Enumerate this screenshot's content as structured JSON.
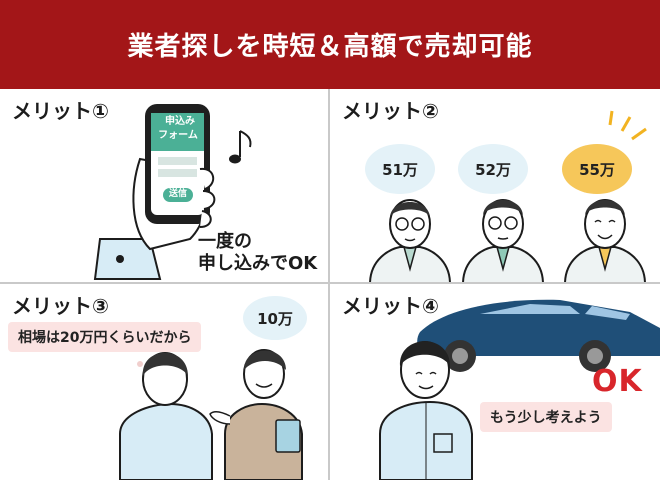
{
  "header": {
    "title": "業者探しを時短＆高額で売却可能"
  },
  "panels": {
    "p1": {
      "title": "メリット①",
      "phone_lines": [
        "申込み",
        "フォーム"
      ],
      "send_button": "送信",
      "caption_lines": [
        "一度の",
        "申し込みでOK"
      ]
    },
    "p2": {
      "title": "メリット②",
      "offers": [
        "51万",
        "52万",
        "55万"
      ]
    },
    "p3": {
      "title": "メリット③",
      "thought": "相場は20万円くらいだから",
      "offer": "10万"
    },
    "p4": {
      "title": "メリット④",
      "ok": "OK",
      "thought": "もう少し考えよう"
    }
  },
  "colors": {
    "header_bg": "#a31618",
    "gold": "#f6c75a",
    "light_blue": "#e4f2f8",
    "pink": "#fbe3e2",
    "ok_red": "#d8262b",
    "car_blue": "#1f4f78"
  }
}
